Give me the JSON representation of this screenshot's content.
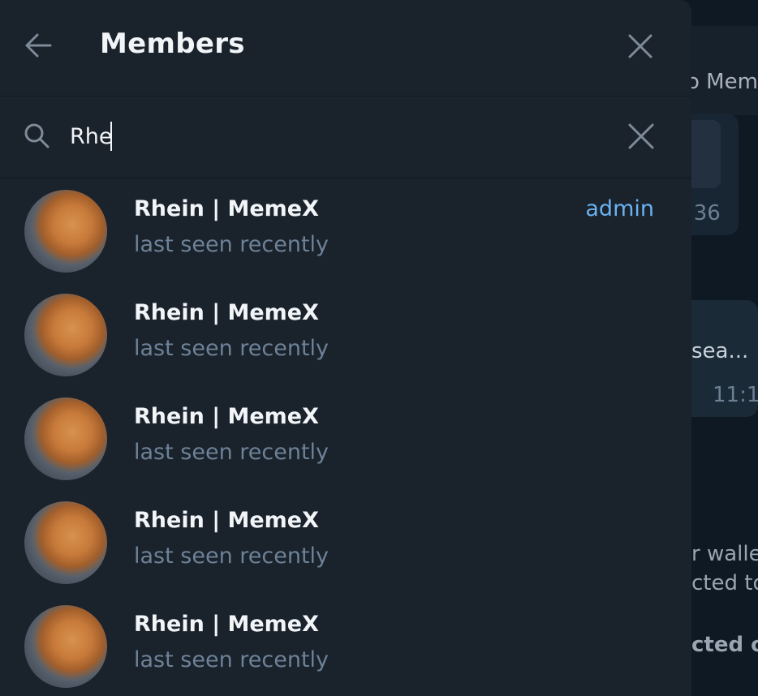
{
  "background_chat": {
    "header_fragment": "o Mem",
    "bubble_time_1": ":36",
    "bubble_text": "sea...",
    "bubble_time_2": "11:1",
    "line_1": "r walle",
    "line_2": "cted to",
    "line_3": "cted o"
  },
  "panel": {
    "title": "Members",
    "search_value": "Rhe"
  },
  "members": [
    {
      "name": "Rhein | MemeX",
      "status": "last seen recently",
      "role": "admin"
    },
    {
      "name": "Rhein | MemeX",
      "status": "last seen recently",
      "role": ""
    },
    {
      "name": "Rhein | MemeX",
      "status": "last seen recently",
      "role": ""
    },
    {
      "name": "Rhein | MemeX",
      "status": "last seen recently",
      "role": ""
    },
    {
      "name": "Rhein | MemeX",
      "status": "last seen recently",
      "role": ""
    }
  ],
  "colors": {
    "panel_bg": "#1a222c",
    "text_primary": "#f2f5f8",
    "text_secondary": "#6d8197",
    "accent": "#6ab2f2"
  },
  "icons": {
    "back": "arrow-left-icon",
    "close": "close-icon",
    "search": "search-icon",
    "clear": "clear-icon"
  }
}
